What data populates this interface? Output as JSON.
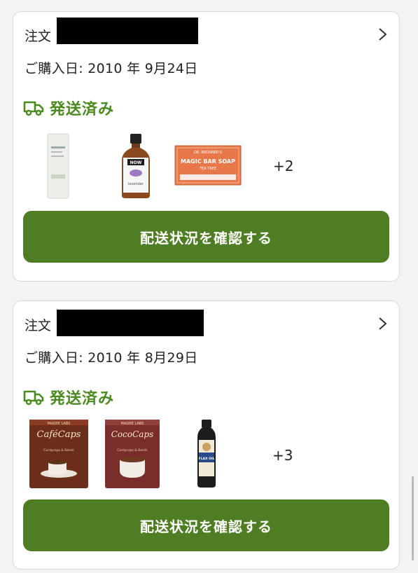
{
  "orders": [
    {
      "order_label": "注文",
      "order_date": "ご購入日: 2010 年 9月24日",
      "status": "発送済み",
      "products": [
        {
          "name": "giovanni-conditioner-bottle"
        },
        {
          "name": "now-lavender-oil-bottle",
          "brand_text": "NOW",
          "label_text": "lavender"
        },
        {
          "name": "dr-bronners-tea-tree-soap",
          "brand_text": "DR. BRONNER'S",
          "label_text": "MAGIC BAR SOAP",
          "sub_text": "TEA TREE"
        }
      ],
      "more_count": "+2",
      "track_button": "配送状況を確認する"
    },
    {
      "order_label": "注文",
      "order_date": "ご購入日: 2010 年 8月29日",
      "status": "発送済み",
      "products": [
        {
          "name": "cafecaps-coffee-pouch",
          "brand_text": "MADRE LABS",
          "label_text": "CaféCaps",
          "sub_text": "Cordyceps & Reishi"
        },
        {
          "name": "cococaps-cocoa-pouch",
          "brand_text": "MADRE LABS",
          "label_text": "CocoCaps",
          "sub_text": "Cordyceps & Reishi"
        },
        {
          "name": "barleans-flax-oil-bottle",
          "label_text": "FLAX OIL"
        }
      ],
      "more_count": "+3",
      "track_button": "配送状況を確認する"
    }
  ],
  "colors": {
    "accent_green": "#4e7d23",
    "status_green": "#4a8a1e",
    "card_border": "#d9d9d9"
  }
}
